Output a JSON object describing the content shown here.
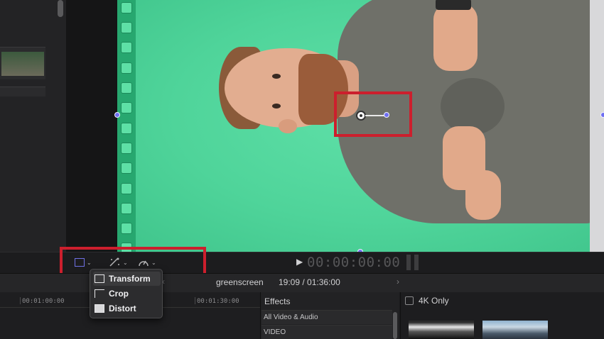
{
  "viewer": {
    "timecode": "00:00:00:00",
    "play_glyph": "▶"
  },
  "toolbar": {
    "tools": [
      {
        "icon": "transform-icon"
      },
      {
        "icon": "enhance-wand-icon"
      },
      {
        "icon": "speed-gauge-icon"
      }
    ]
  },
  "popup_menu": {
    "items": [
      {
        "label": "Transform",
        "icon": "transform-icon",
        "selected": true
      },
      {
        "label": "Crop",
        "icon": "crop-icon",
        "selected": false
      },
      {
        "label": "Distort",
        "icon": "distort-icon",
        "selected": false
      }
    ]
  },
  "timeline_header": {
    "project_name": "greenscreen",
    "duration": "19:09 / 01:36:00",
    "back_glyph": "‹",
    "forward_glyph": "›"
  },
  "timeline": {
    "ruler_labels": [
      "00:01:00:00",
      "00:01:30:00"
    ]
  },
  "effects": {
    "title": "Effects",
    "categories": [
      "All Video & Audio",
      "VIDEO"
    ]
  },
  "effect_preview": {
    "checkbox_label": "4K Only",
    "checked": false
  },
  "colors": {
    "green_screen": "#4fd59b",
    "selection_highlight": "#cc1f2d",
    "handle_accent": "#6f71e5"
  }
}
